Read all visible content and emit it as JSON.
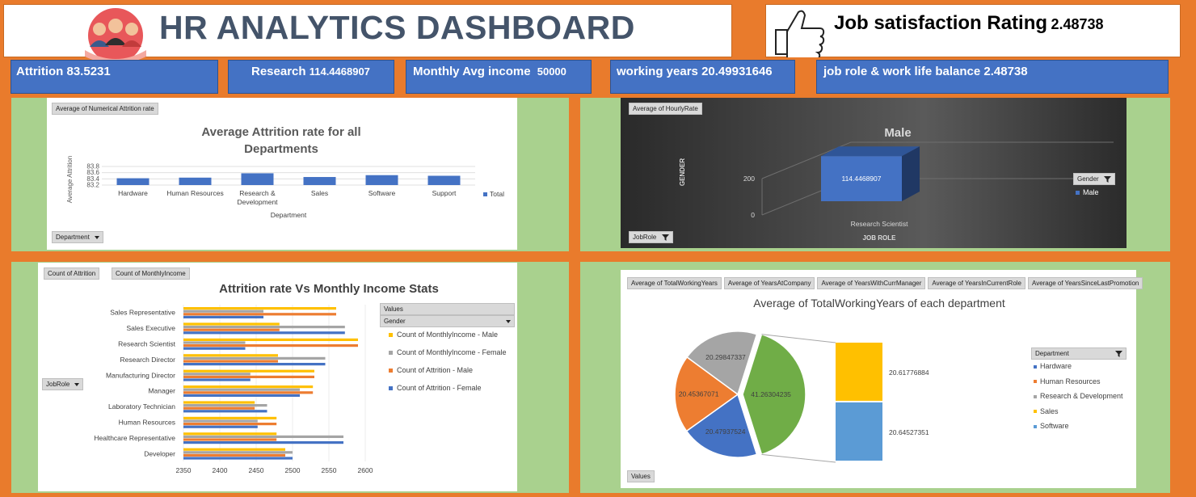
{
  "header": {
    "title": "HR ANALYTICS DASHBOARD",
    "job_satisfaction_label": "Job satisfaction Rating",
    "job_satisfaction_value": "2.48738"
  },
  "kpis": [
    {
      "label": "Attrition",
      "value": "83.5231"
    },
    {
      "label": "Research",
      "value": "114.4468907"
    },
    {
      "label": "Monthly Avg income",
      "value": "50000"
    },
    {
      "label": "working years",
      "value": "20.49931646"
    },
    {
      "label": "job role & work life balance",
      "value": "2.48738"
    }
  ],
  "chart1": {
    "field_button": "Average of Numerical Attrition rate",
    "filter_button": "Department",
    "title_line1": "Average Attrition rate for all",
    "title_line2": "Departments",
    "legend": "Total"
  },
  "chart2": {
    "field_button": "Average of HourlyRate",
    "filter_button": "JobRole",
    "legend_button": "Gender",
    "legend": "Male",
    "title": "Male",
    "ylabel": "GENDER",
    "xlabel": "JOB ROLE",
    "category": "Research Scientist",
    "value_label": "114.4468907"
  },
  "chart3": {
    "buttons": [
      "Count of Attrition",
      "Count of MonthlyIncome"
    ],
    "row_button": "JobRole",
    "title": "Attrition rate Vs Monthly Income  Stats",
    "values_label": "Values",
    "gender_button": "Gender"
  },
  "chart4": {
    "buttons": [
      "Average of TotalWorkingYears",
      "Average of YearsAtCompany",
      "Average of YearsWithCurrManager",
      "Average of YearsInCurrentRole",
      "Average of YearsSinceLastPromotion"
    ],
    "title": "Average of TotalWorkingYears of each department",
    "legend_button": "Department",
    "values_button": "Values"
  },
  "colors": {
    "blue": "#4472c4",
    "orange": "#ed7d31",
    "gray": "#a5a5a5",
    "gold": "#ffc000",
    "lightblue": "#5b9bd5",
    "green": "#70ad47"
  },
  "chart_data": [
    {
      "type": "bar",
      "title": "Average Attrition rate for all Departments",
      "xlabel": "Department",
      "ylabel": "Average Attrition",
      "categories": [
        "Hardware",
        "Human Resources",
        "Research & Development",
        "Sales",
        "Software",
        "Support"
      ],
      "ytick_labels": [
        "83.2",
        "83.4",
        "83.6",
        "83.8"
      ],
      "ylim": [
        83.2,
        83.8
      ],
      "series": [
        {
          "name": "Total",
          "values": [
            83.42,
            83.44,
            83.58,
            83.46,
            83.52,
            83.5
          ]
        }
      ]
    },
    {
      "type": "bar",
      "title": "Male",
      "xlabel": "JOB ROLE",
      "ylabel": "GENDER",
      "categories": [
        "Research Scientist"
      ],
      "ytick_labels": [
        "0",
        "200"
      ],
      "ylim": [
        0,
        200
      ],
      "series": [
        {
          "name": "Male",
          "values": [
            114.4468907
          ]
        }
      ]
    },
    {
      "type": "bar",
      "orientation": "horizontal",
      "title": "Attrition rate Vs Monthly Income  Stats",
      "categories": [
        "Developer",
        "Healthcare Representative",
        "Human Resources",
        "Laboratory Technician",
        "Manager",
        "Manufacturing Director",
        "Research Director",
        "Research Scientist",
        "Sales Executive",
        "Sales Representative"
      ],
      "xtick_labels": [
        "2350",
        "2400",
        "2450",
        "2500",
        "2550",
        "2600"
      ],
      "xlim": [
        2350,
        2600
      ],
      "series": [
        {
          "name": "Count of MonthlyIncome - Male",
          "values": [
            2490,
            2478,
            2478,
            2448,
            2528,
            2530,
            2480,
            2590,
            2482,
            2560
          ]
        },
        {
          "name": "Count of MonthlyIncome - Female",
          "values": [
            2500,
            2570,
            2452,
            2465,
            2510,
            2442,
            2545,
            2435,
            2572,
            2460
          ]
        },
        {
          "name": "Count of Attrition - Male",
          "values": [
            2490,
            2478,
            2478,
            2448,
            2528,
            2530,
            2480,
            2590,
            2482,
            2560
          ]
        },
        {
          "name": "Count of Attrition - Female",
          "values": [
            2500,
            2570,
            2452,
            2465,
            2510,
            2442,
            2545,
            2435,
            2572,
            2460
          ]
        }
      ]
    },
    {
      "type": "pie",
      "title": "Average of TotalWorkingYears of each department",
      "labels": [
        "Hardware",
        "Human Resources",
        "Research & Development",
        "Sales",
        "Software"
      ],
      "slice_labels": [
        "20.47937524",
        "20.45367071",
        "20.29847337",
        "41.26304235"
      ],
      "values": [
        20.47937524,
        20.45367071,
        20.29847337,
        41.26304235
      ],
      "secondary": [
        {
          "label": "20.61776884",
          "value": 20.61776884,
          "color": "#ffc000"
        },
        {
          "label": "20.64527351",
          "value": 20.64527351,
          "color": "#5b9bd5"
        }
      ]
    }
  ]
}
